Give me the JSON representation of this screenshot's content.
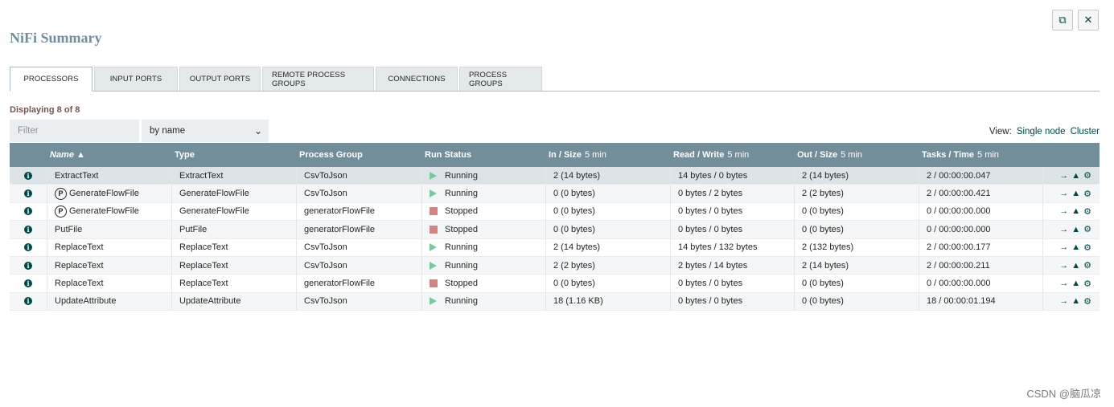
{
  "page": {
    "title": "NiFi Summary",
    "top_buttons": [
      {
        "icon": "popout-icon",
        "glyph": "⧉"
      },
      {
        "icon": "close-icon",
        "glyph": "✕"
      }
    ]
  },
  "tabs": [
    {
      "label": "PROCESSORS",
      "active": true
    },
    {
      "label": "INPUT PORTS",
      "active": false
    },
    {
      "label": "OUTPUT PORTS",
      "active": false
    },
    {
      "label": "REMOTE PROCESS GROUPS",
      "active": false
    },
    {
      "label": "CONNECTIONS",
      "active": false
    },
    {
      "label": "PROCESS GROUPS",
      "active": false
    }
  ],
  "displaying": "Displaying 8 of 8",
  "filter": {
    "placeholder": "Filter",
    "select_value": "by name"
  },
  "view": {
    "label": "View:",
    "single_node": "Single node",
    "cluster": "Cluster"
  },
  "table": {
    "columns": [
      {
        "key": "name",
        "label": "Name ▲",
        "unit": ""
      },
      {
        "key": "type",
        "label": "Type",
        "unit": ""
      },
      {
        "key": "group",
        "label": "Process Group",
        "unit": ""
      },
      {
        "key": "status",
        "label": "Run Status",
        "unit": ""
      },
      {
        "key": "in",
        "label": "In / Size",
        "unit": "5 min"
      },
      {
        "key": "rw",
        "label": "Read / Write",
        "unit": "5 min"
      },
      {
        "key": "out",
        "label": "Out / Size",
        "unit": "5 min"
      },
      {
        "key": "tasks",
        "label": "Tasks / Time",
        "unit": "5 min"
      }
    ],
    "rows": [
      {
        "name": "ExtractText",
        "primary": false,
        "type": "ExtractText",
        "group": "CsvToJson",
        "status": "Running",
        "in": "2 (14 bytes)",
        "rw": "14 bytes / 0 bytes",
        "out": "2 (14 bytes)",
        "tasks": "2 / 00:00:00.047"
      },
      {
        "name": "GenerateFlowFile",
        "primary": true,
        "type": "GenerateFlowFile",
        "group": "CsvToJson",
        "status": "Running",
        "in": "0 (0 bytes)",
        "rw": "0 bytes / 2 bytes",
        "out": "2 (2 bytes)",
        "tasks": "2 / 00:00:00.421"
      },
      {
        "name": "GenerateFlowFile",
        "primary": true,
        "type": "GenerateFlowFile",
        "group": "generatorFlowFile",
        "status": "Stopped",
        "in": "0 (0 bytes)",
        "rw": "0 bytes / 0 bytes",
        "out": "0 (0 bytes)",
        "tasks": "0 / 00:00:00.000"
      },
      {
        "name": "PutFile",
        "primary": false,
        "type": "PutFile",
        "group": "generatorFlowFile",
        "status": "Stopped",
        "in": "0 (0 bytes)",
        "rw": "0 bytes / 0 bytes",
        "out": "0 (0 bytes)",
        "tasks": "0 / 00:00:00.000"
      },
      {
        "name": "ReplaceText",
        "primary": false,
        "type": "ReplaceText",
        "group": "CsvToJson",
        "status": "Running",
        "in": "2 (14 bytes)",
        "rw": "14 bytes / 132 bytes",
        "out": "2 (132 bytes)",
        "tasks": "2 / 00:00:00.177"
      },
      {
        "name": "ReplaceText",
        "primary": false,
        "type": "ReplaceText",
        "group": "CsvToJson",
        "status": "Running",
        "in": "2 (2 bytes)",
        "rw": "2 bytes / 14 bytes",
        "out": "2 (14 bytes)",
        "tasks": "2 / 00:00:00.211"
      },
      {
        "name": "ReplaceText",
        "primary": false,
        "type": "ReplaceText",
        "group": "generatorFlowFile",
        "status": "Stopped",
        "in": "0 (0 bytes)",
        "rw": "0 bytes / 0 bytes",
        "out": "0 (0 bytes)",
        "tasks": "0 / 00:00:00.000"
      },
      {
        "name": "UpdateAttribute",
        "primary": false,
        "type": "UpdateAttribute",
        "group": "CsvToJson",
        "status": "Running",
        "in": "18 (1.16 KB)",
        "rw": "0 bytes / 0 bytes",
        "out": "0 (0 bytes)",
        "tasks": "18 / 00:00:01.194"
      }
    ],
    "row_icons": {
      "info": "i",
      "primary_badge": "P",
      "goto": "→",
      "history": "▲",
      "cluster": "⚙"
    }
  },
  "watermark": "CSDN @脑瓜凉",
  "colors": {
    "header_bg": "#728e9b",
    "title": "#728e9b",
    "running": "#7dc7a0",
    "stopped": "#d18686",
    "accent": "#004849"
  }
}
